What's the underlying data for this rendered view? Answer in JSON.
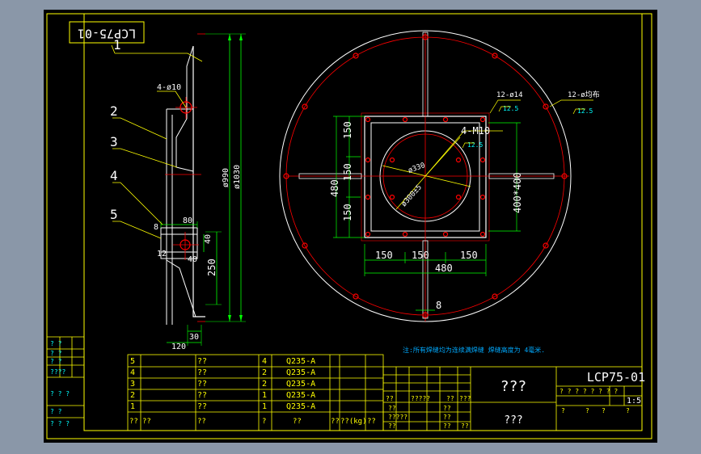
{
  "drawing": {
    "code": "LCP75-01",
    "code_rotated": "LCP75-01",
    "scale": "1:5",
    "title_main": "???",
    "title_sub": "???",
    "note": "注:所有焊缝均为连续满焊缝 焊缝高度为 4毫米."
  },
  "colors": {
    "frame": "#ffff00",
    "dimension": "#00ff00",
    "outline": "#ffffff",
    "centerline": "#ff0000",
    "leader": "#ffff00",
    "text": "#ffff00",
    "note": "#00aaff",
    "cyan": "#00ffff"
  },
  "side_view": {
    "hole_label": "4-ø10",
    "dim_d990": "ø990",
    "dim_d1030": "ø1030",
    "dim_80": "80",
    "dim_40a": "40",
    "dim_40b": "40",
    "dim_12": "12",
    "dim_8": "8",
    "dim_250": "250",
    "dim_30": "30",
    "dim_120": "120",
    "part_labels": [
      "1",
      "2",
      "3",
      "4",
      "5"
    ]
  },
  "plan_view": {
    "bolt_label_outer": "12-ø均布",
    "bolt_label_14": "12-ø14",
    "rough_12_5a": "12.5",
    "rough_12_5b": "12.5",
    "rough_12_5c": "12.5",
    "m10_label": "4-M10",
    "d330": "ø330",
    "d300": "ø300±5",
    "dim_150_top": "150",
    "dim_150_mid": "150",
    "dim_150_bot": "150",
    "dim_480_v": "480",
    "dim_400x400": "400*400",
    "dim_150_h1": "150",
    "dim_150_h2": "150",
    "dim_150_h3": "150",
    "dim_480_h": "480",
    "dim_8": "8"
  },
  "bom": {
    "rows": [
      {
        "no": "5",
        "name": "??",
        "qty": "4",
        "material": "Q235-A"
      },
      {
        "no": "4",
        "name": "??",
        "qty": "2",
        "material": "Q235-A"
      },
      {
        "no": "3",
        "name": "??",
        "qty": "2",
        "material": "Q235-A"
      },
      {
        "no": "2",
        "name": "??",
        "qty": "1",
        "material": "Q235-A"
      },
      {
        "no": "1",
        "name": "??",
        "qty": "1",
        "material": "Q235-A"
      }
    ],
    "header": {
      "no": "??",
      "code": "??",
      "name": "??",
      "qty": "?",
      "material": "??",
      "c6": "??",
      "weight": "??(kg)",
      "remark": "??"
    }
  },
  "title_block": {
    "left_a": "??",
    "left_b": "?????",
    "left_c": "??",
    "left_d": "???",
    "r1": "??",
    "r2": "?????",
    "r3": "??",
    "r4": "??",
    "r5": "??",
    "r6": "??",
    "r7": "??",
    "scale_label": "?  ?  ?  ?  ?  ?  ?  ?",
    "small_a": "?",
    "small_b": "?",
    "small_c": "?",
    "small_d": "?"
  },
  "left_strip": {
    "s1": "? ?",
    "s2": "? ?",
    "s3": "? ?",
    "s4": "????",
    "s5": "? ? ?",
    "s6": "? ?",
    "s7": "? ? ?"
  }
}
